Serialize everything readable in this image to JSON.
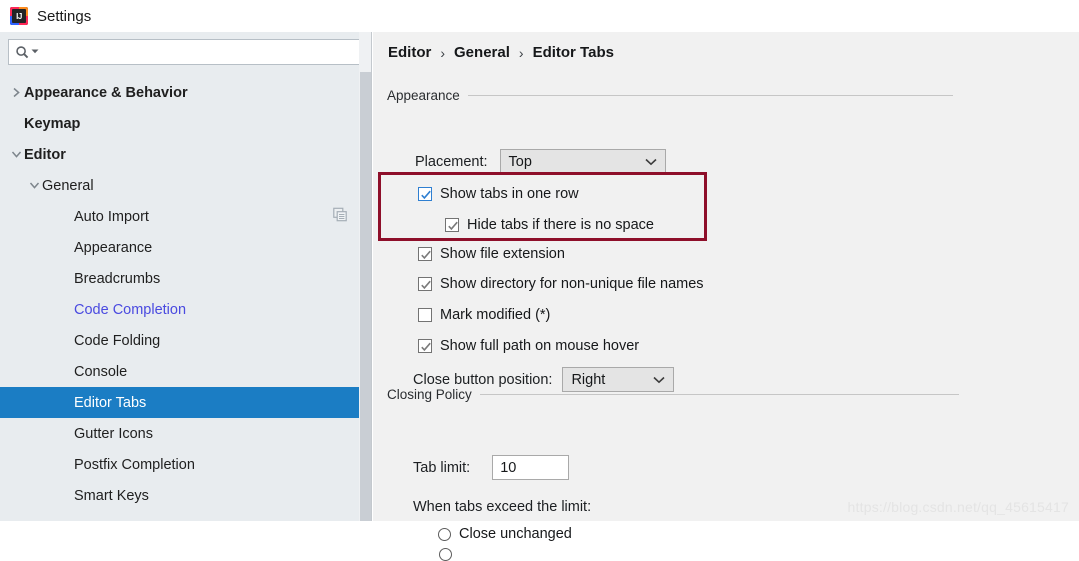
{
  "window": {
    "title": "Settings",
    "app_icon": "intellij-idea-icon",
    "icon_text": "IJ"
  },
  "search": {
    "icon": "search-icon",
    "value": "",
    "placeholder": ""
  },
  "sidebar": {
    "items": [
      {
        "label": "Appearance & Behavior",
        "level": 0,
        "twisty": "collapsed",
        "selected": false,
        "modified": false
      },
      {
        "label": "Keymap",
        "level": 0,
        "twisty": "none",
        "selected": false,
        "modified": false
      },
      {
        "label": "Editor",
        "level": 0,
        "twisty": "expanded",
        "selected": false,
        "modified": false
      },
      {
        "label": "General",
        "level": 1,
        "twisty": "expanded",
        "selected": false,
        "modified": false
      },
      {
        "label": "Auto Import",
        "level": 2,
        "twisty": "none",
        "selected": false,
        "modified": false,
        "trailing_icon": "copy-icon"
      },
      {
        "label": "Appearance",
        "level": 2,
        "twisty": "none",
        "selected": false,
        "modified": false
      },
      {
        "label": "Breadcrumbs",
        "level": 2,
        "twisty": "none",
        "selected": false,
        "modified": false
      },
      {
        "label": "Code Completion",
        "level": 2,
        "twisty": "none",
        "selected": false,
        "modified": true
      },
      {
        "label": "Code Folding",
        "level": 2,
        "twisty": "none",
        "selected": false,
        "modified": false
      },
      {
        "label": "Console",
        "level": 2,
        "twisty": "none",
        "selected": false,
        "modified": false
      },
      {
        "label": "Editor Tabs",
        "level": 2,
        "twisty": "none",
        "selected": true,
        "modified": false
      },
      {
        "label": "Gutter Icons",
        "level": 2,
        "twisty": "none",
        "selected": false,
        "modified": false
      },
      {
        "label": "Postfix Completion",
        "level": 2,
        "twisty": "none",
        "selected": false,
        "modified": false
      },
      {
        "label": "Smart Keys",
        "level": 2,
        "twisty": "none",
        "selected": false,
        "modified": false
      }
    ]
  },
  "breadcrumb": {
    "separator": "›",
    "items": [
      "Editor",
      "General",
      "Editor Tabs"
    ]
  },
  "appearance": {
    "group_label": "Appearance",
    "placement": {
      "label": "Placement:",
      "value": "Top",
      "caret": "chevron-down-icon"
    },
    "checkboxes": [
      {
        "label": "Show tabs in one row",
        "checked": true,
        "focused": true,
        "indent": 0
      },
      {
        "label": "Hide tabs if there is no space",
        "checked": true,
        "focused": false,
        "indent": 1
      },
      {
        "label": "Show file extension",
        "checked": true,
        "focused": false,
        "indent": 0
      },
      {
        "label": "Show directory for non-unique file names",
        "checked": true,
        "focused": false,
        "indent": 0
      },
      {
        "label": "Mark modified (*)",
        "checked": false,
        "focused": false,
        "indent": 0
      },
      {
        "label": "Show full path on mouse hover",
        "checked": true,
        "focused": false,
        "indent": 0
      }
    ],
    "close_button_position": {
      "label": "Close button position:",
      "value": "Right",
      "caret": "chevron-down-icon"
    }
  },
  "closing_policy": {
    "group_label": "Closing Policy",
    "tab_limit": {
      "label": "Tab limit:",
      "value": "10"
    },
    "when_exceed_label": "When tabs exceed the limit:",
    "options": [
      {
        "label": "Close unchanged",
        "selected": false
      }
    ]
  },
  "annotation": {
    "box_color": "#8e0f2a"
  },
  "watermark": {
    "text": "https://blog.csdn.net/qq_45615417"
  }
}
